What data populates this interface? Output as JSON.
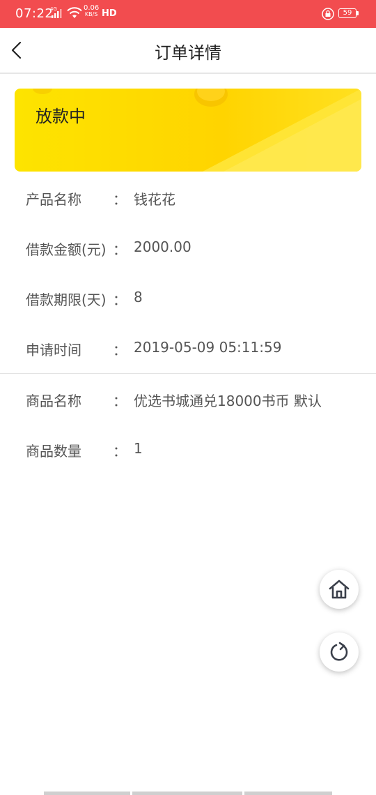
{
  "status_bar": {
    "time": "07:22",
    "network": "4G",
    "speed_value": "0.06",
    "speed_unit": "KB/S",
    "hd": "HD",
    "battery": "59"
  },
  "header": {
    "title": "订单详情"
  },
  "banner": {
    "status": "放款中"
  },
  "details": {
    "product_name": {
      "label": "产品名称",
      "value": "钱花花"
    },
    "loan_amount": {
      "label": "借款金额(元)",
      "value": "2000.00"
    },
    "loan_term": {
      "label": "借款期限(天)",
      "value": "8"
    },
    "apply_time": {
      "label": "申请时间",
      "value": "2019-05-09 05:11:59"
    }
  },
  "goods": {
    "goods_name": {
      "label": "商品名称",
      "value": "优选书城通兑18000书币 默认"
    },
    "goods_quantity": {
      "label": "商品数量",
      "value": "1"
    }
  },
  "colon": "："
}
